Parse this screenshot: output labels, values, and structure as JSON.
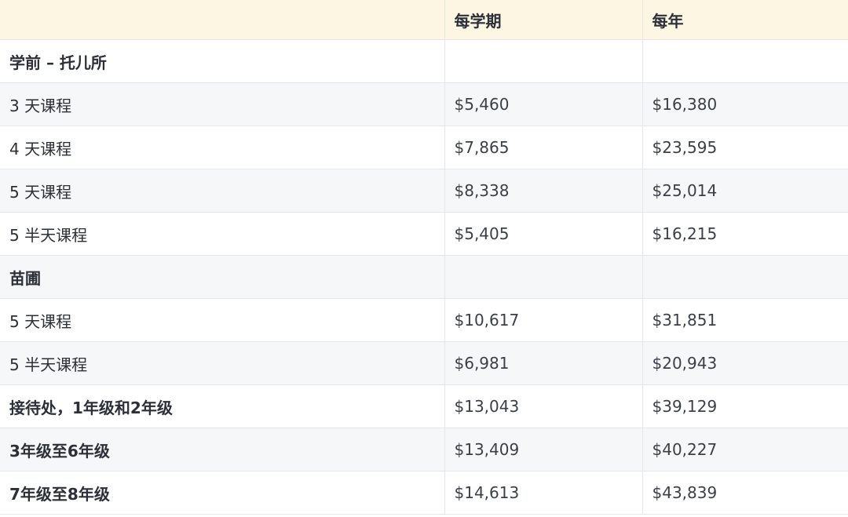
{
  "header": {
    "col0": "",
    "col1": "每学期",
    "col2": "每年"
  },
  "rows": [
    {
      "label": "学前 – 托儿所",
      "per_term": "",
      "per_year": "",
      "section": true
    },
    {
      "label": "3 天课程",
      "per_term": "$5,460",
      "per_year": "$16,380",
      "section": false
    },
    {
      "label": "4 天课程",
      "per_term": "$7,865",
      "per_year": "$23,595",
      "section": false
    },
    {
      "label": "5 天课程",
      "per_term": "$8,338",
      "per_year": "$25,014",
      "section": false
    },
    {
      "label": "5 半天课程",
      "per_term": "$5,405",
      "per_year": "$16,215",
      "section": false
    },
    {
      "label": "苗圃",
      "per_term": "",
      "per_year": "",
      "section": true
    },
    {
      "label": "5 天课程",
      "per_term": "$10,617",
      "per_year": "$31,851",
      "section": false
    },
    {
      "label": "5 半天课程",
      "per_term": "$6,981",
      "per_year": "$20,943",
      "section": false
    },
    {
      "label": "接待处，1年级和2年级",
      "per_term": "$13,043",
      "per_year": "$39,129",
      "section": true
    },
    {
      "label": "3年级至6年级",
      "per_term": "$13,409",
      "per_year": "$40,227",
      "section": true
    },
    {
      "label": "7年级至8年级",
      "per_term": "$14,613",
      "per_year": "$43,839",
      "section": true
    }
  ],
  "colors": {
    "header_bg": "#fdf6e3",
    "stripe_bg": "#f6f7f9",
    "border": "#e3e6ea",
    "text": "#2b2f38"
  }
}
